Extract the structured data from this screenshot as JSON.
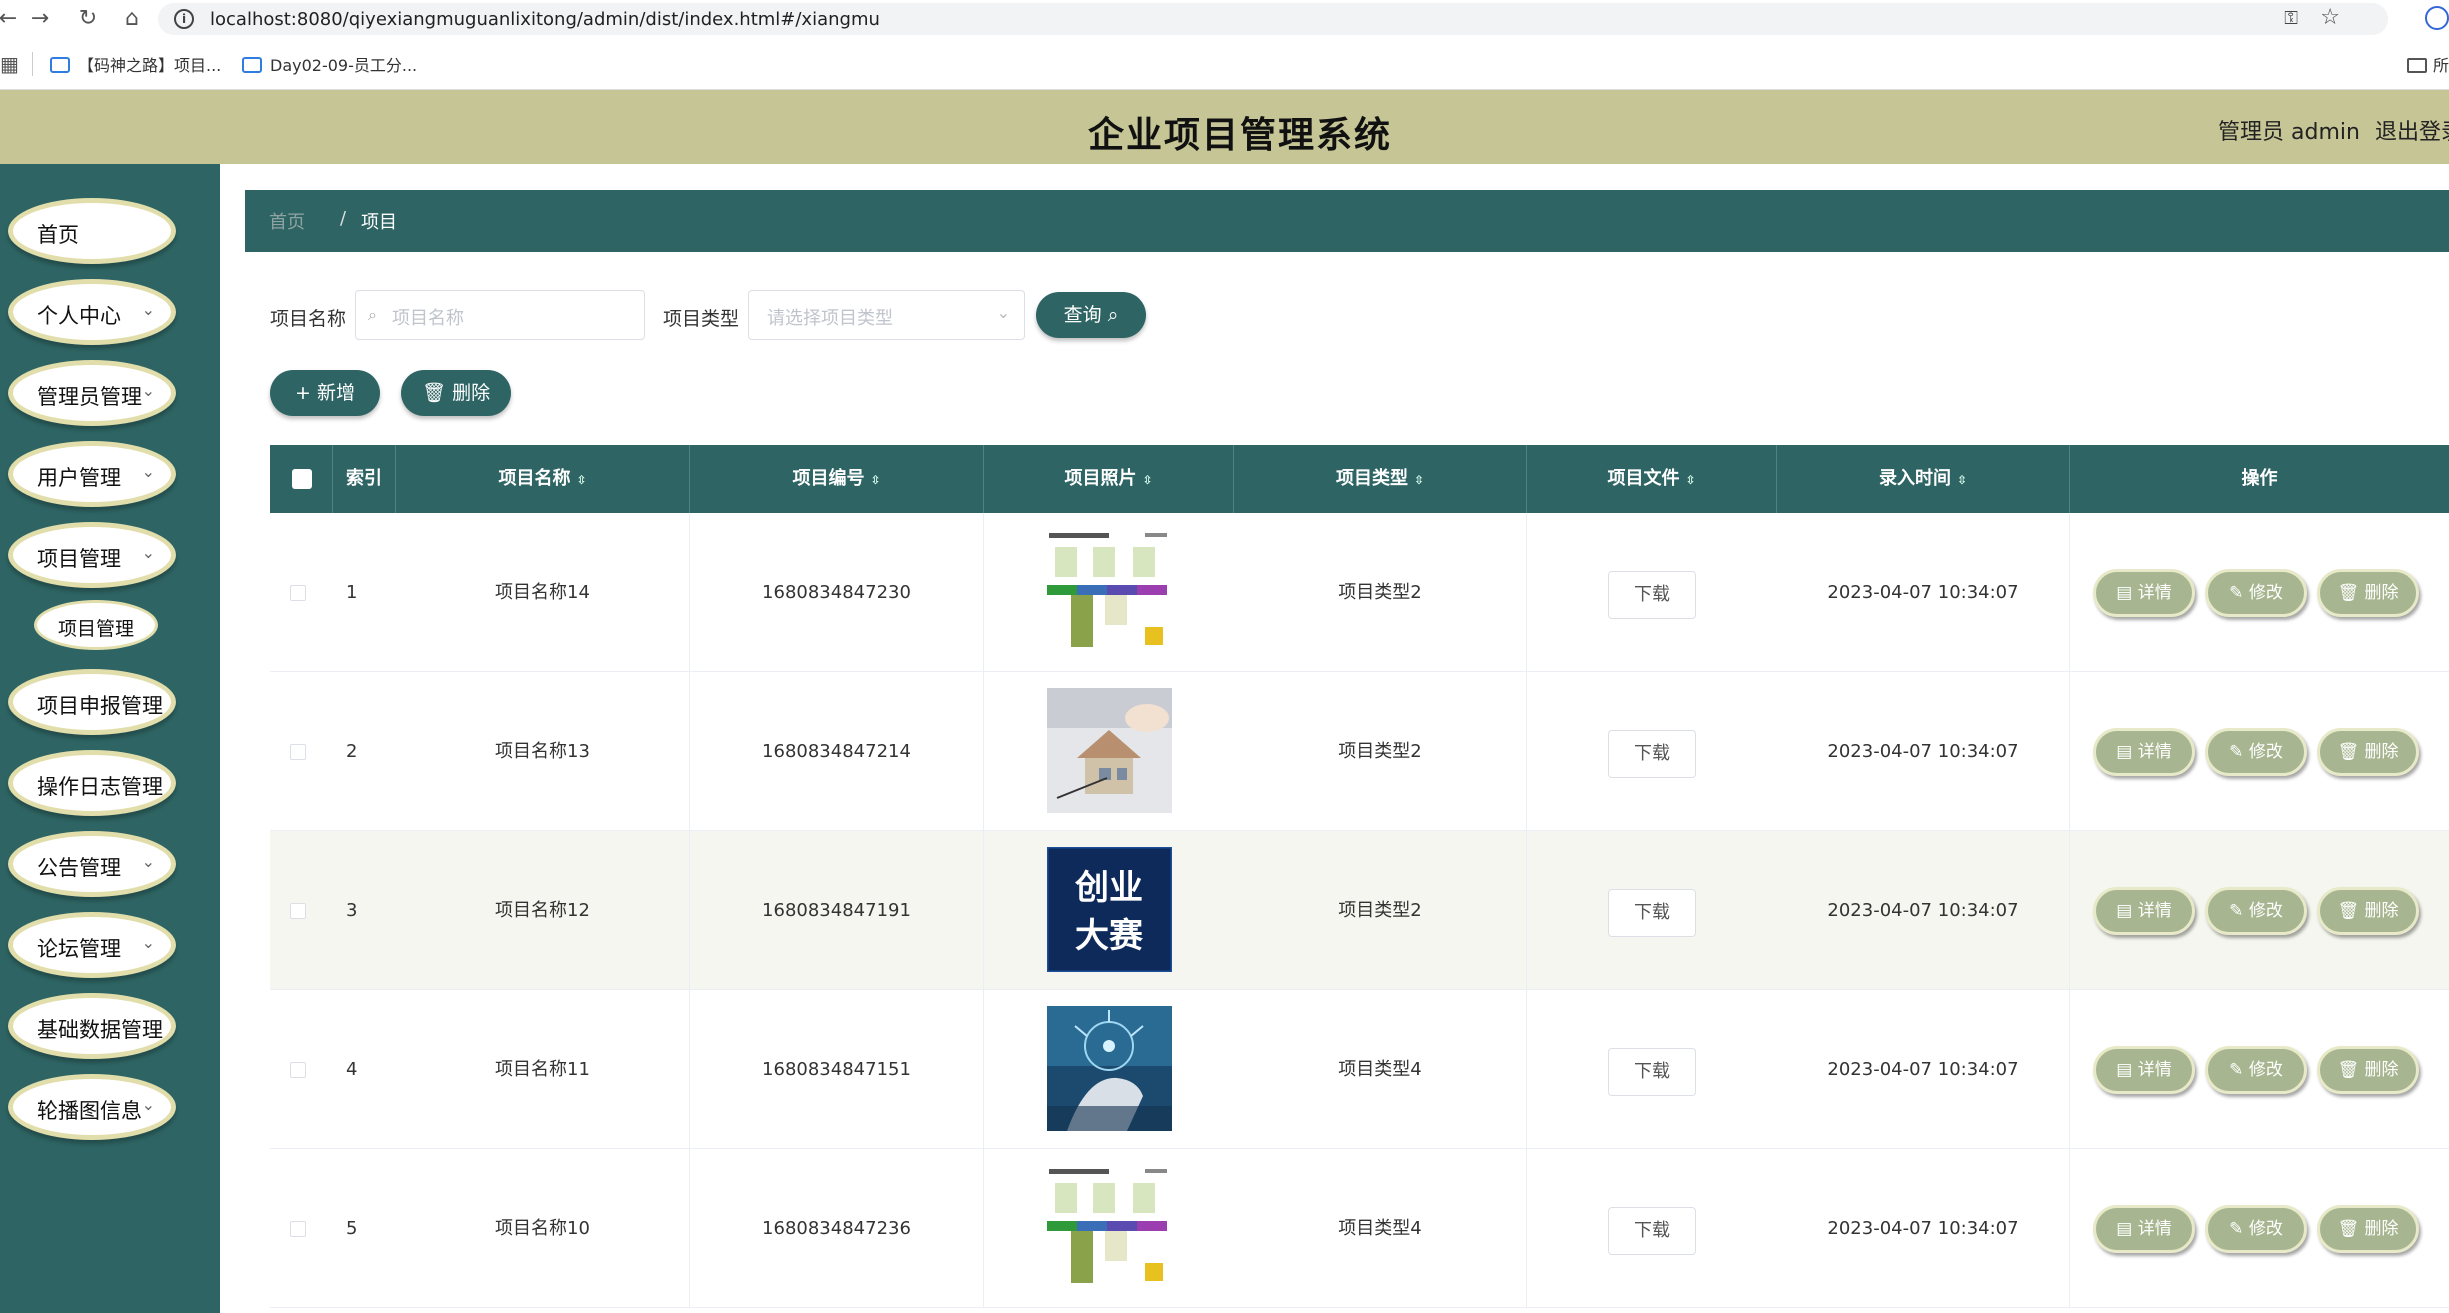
{
  "browser": {
    "url": "localhost:8080/qiyexiangmuguanlixitong/admin/dist/index.html#/xiangmu",
    "bookmarks": [
      "【码神之路】项目...",
      "Day02-09-员工分..."
    ],
    "bookmark_folder": "所"
  },
  "header": {
    "title": "企业项目管理系统",
    "admin_label": "管理员 admin",
    "logout_label": "退出登录"
  },
  "sidebar": {
    "items": [
      {
        "label": "首页",
        "has_arrow": false
      },
      {
        "label": "个人中心",
        "has_arrow": true
      },
      {
        "label": "管理员管理",
        "has_arrow": true
      },
      {
        "label": "用户管理",
        "has_arrow": true
      },
      {
        "label": "项目管理",
        "has_arrow": true
      },
      {
        "label": "项目申报管理",
        "has_arrow": true
      },
      {
        "label": "操作日志管理",
        "has_arrow": true
      },
      {
        "label": "公告管理",
        "has_arrow": true
      },
      {
        "label": "论坛管理",
        "has_arrow": true
      },
      {
        "label": "基础数据管理",
        "has_arrow": true
      },
      {
        "label": "轮播图信息",
        "has_arrow": true
      }
    ],
    "submenu_label": "项目管理"
  },
  "breadcrumb": {
    "home": "首页",
    "separator": "/",
    "current": "项目"
  },
  "filters": {
    "name_label": "项目名称",
    "name_placeholder": "项目名称",
    "type_label": "项目类型",
    "type_placeholder": "请选择项目类型",
    "query_label": "查询"
  },
  "actions": {
    "add_label": "+ 新增",
    "delete_label": "删除"
  },
  "table": {
    "headers": {
      "index": "索引",
      "name": "项目名称",
      "code": "项目编号",
      "photo": "项目照片",
      "type": "项目类型",
      "file": "项目文件",
      "time": "录入时间",
      "ops": "操作"
    },
    "download_label": "下载",
    "op_labels": {
      "detail": "详情",
      "edit": "修改",
      "delete": "删除"
    },
    "rows": [
      {
        "index": "1",
        "name": "项目名称14",
        "code": "1680834847230",
        "type": "项目类型2",
        "time": "2023-04-07 10:34:07",
        "photo": "infographic"
      },
      {
        "index": "2",
        "name": "项目名称13",
        "code": "1680834847214",
        "type": "项目类型2",
        "time": "2023-04-07 10:34:07",
        "photo": "house-model"
      },
      {
        "index": "3",
        "name": "项目名称12",
        "code": "1680834847191",
        "type": "项目类型2",
        "time": "2023-04-07 10:34:07",
        "photo": "contest-poster",
        "poster_text": [
          "创业",
          "大赛"
        ]
      },
      {
        "index": "4",
        "name": "项目名称11",
        "code": "1680834847151",
        "type": "项目类型4",
        "time": "2023-04-07 10:34:07",
        "photo": "tech-hand"
      },
      {
        "index": "5",
        "name": "项目名称10",
        "code": "1680834847236",
        "type": "项目类型4",
        "time": "2023-04-07 10:34:07",
        "photo": "infographic"
      }
    ]
  },
  "colors": {
    "primary": "#2e6564",
    "header_bg": "#c6c596",
    "menu_border": "#e2deac",
    "op_button": "#a7b690"
  }
}
